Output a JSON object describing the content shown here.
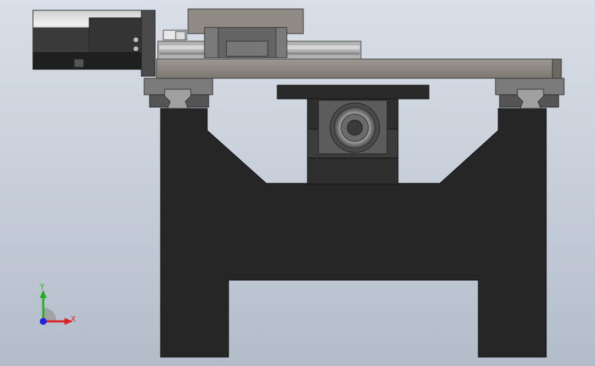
{
  "viewport": {
    "background_top": "#d9dfe8",
    "background_bottom": "#b3bdca"
  },
  "model": {
    "parts": [
      "servo-motor",
      "linear-slide-carriage",
      "cross-beam",
      "linear-guide-blocks",
      "support-frame",
      "pillow-block-bearing"
    ],
    "colors": {
      "frame": "#262626",
      "beam": "#8c8880",
      "rail": "#a8a8a8",
      "motor": "#3a3a3a",
      "bearing": "#555555"
    }
  },
  "triad": {
    "x_label": "X",
    "y_label": "Y",
    "x_color": "#e02020",
    "y_color": "#20b020",
    "z_color": "#2020e0"
  }
}
